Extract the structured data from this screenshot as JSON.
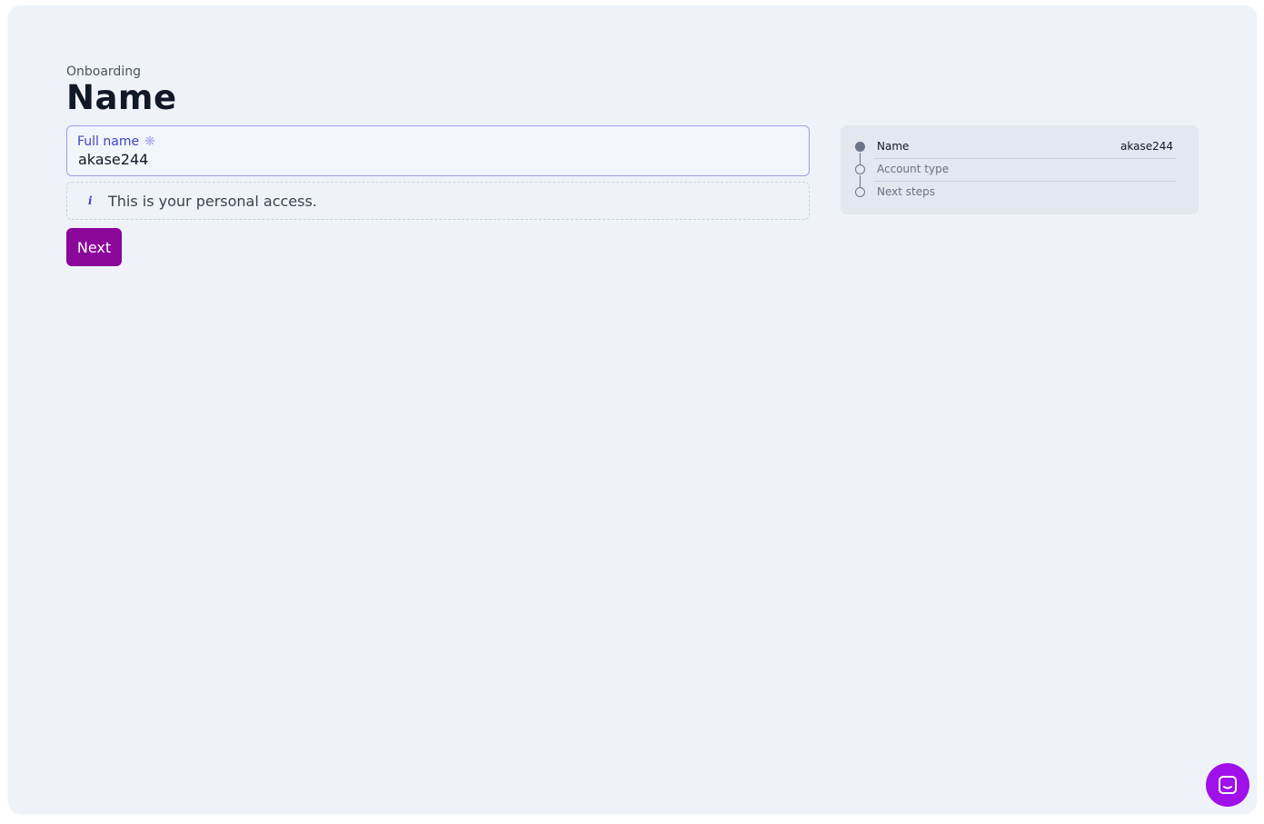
{
  "header": {
    "breadcrumb": "Onboarding",
    "title": "Name"
  },
  "form": {
    "full_name": {
      "label": "Full name",
      "value": "akase244"
    },
    "hint": "This is your personal access.",
    "next_label": "Next"
  },
  "stepper": {
    "steps": [
      {
        "label": "Name",
        "value": "akase244",
        "active": true
      },
      {
        "label": "Account type",
        "value": "",
        "active": false
      },
      {
        "label": "Next steps",
        "value": "",
        "active": false
      }
    ]
  },
  "colors": {
    "background": "#eff3f9",
    "accent": "#3f44c4",
    "primary_button": "#8a079a",
    "chat_button": "#a010e8"
  },
  "icons": {
    "required": "asterisk-icon",
    "info": "info-icon",
    "chat": "chat-icon"
  }
}
